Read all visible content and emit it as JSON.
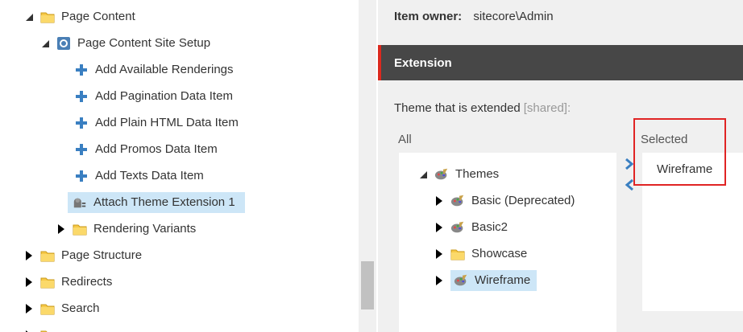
{
  "tree": {
    "page_content": "Page Content",
    "page_content_site_setup": "Page Content Site Setup",
    "add_available_renderings": "Add Available Renderings",
    "add_pagination_data_item": "Add Pagination Data Item",
    "add_plain_html_data_item": "Add Plain HTML Data Item",
    "add_promos_data_item": "Add Promos Data Item",
    "add_texts_data_item": "Add Texts Data Item",
    "attach_theme_extension": "Attach Theme Extension 1",
    "rendering_variants": "Rendering Variants",
    "page_structure": "Page Structure",
    "redirects": "Redirects",
    "search": "Search"
  },
  "item_owner": {
    "label": "Item owner:",
    "value": "sitecore\\Admin"
  },
  "section": {
    "title": "Extension"
  },
  "field": {
    "label": "Theme that is extended",
    "shared": "[shared]:"
  },
  "lists": {
    "all_label": "All",
    "selected_label": "Selected"
  },
  "themes_tree": {
    "root": "Themes",
    "items": [
      "Basic (Deprecated)",
      "Basic2",
      "Showcase",
      "Wireframe"
    ]
  },
  "selected_items": [
    "Wireframe"
  ],
  "colors": {
    "accent_red": "#dc291e",
    "header_bg": "#474747",
    "selection_bg": "#cde6f7",
    "link_blue": "#3a7fc1"
  },
  "icons": {
    "folder": "folder-icon",
    "site_setup": "site-setup-icon",
    "plus": "add-item-icon",
    "extension": "theme-extension-icon",
    "theme": "theme-palette-icon"
  }
}
